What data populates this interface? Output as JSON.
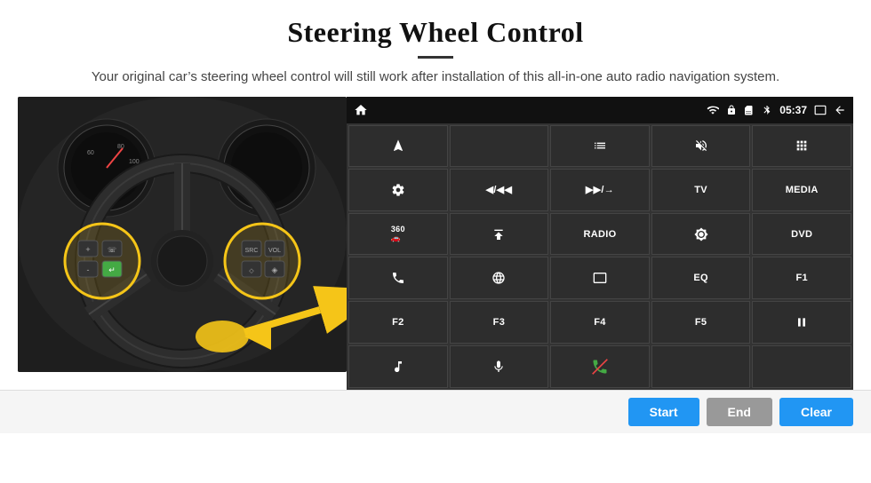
{
  "header": {
    "title": "Steering Wheel Control",
    "subtitle": "Your original car’s steering wheel control will still work after installation of this all-in-one auto radio navigation system."
  },
  "status_bar": {
    "time": "05:37",
    "icons": [
      "wifi",
      "lock",
      "sim",
      "bluetooth",
      "battery",
      "screen",
      "back"
    ]
  },
  "button_grid": [
    {
      "id": "r0c0",
      "type": "icon",
      "icon": "home",
      "label": ""
    },
    {
      "id": "r0c1",
      "type": "icon",
      "icon": "send",
      "label": ""
    },
    {
      "id": "r0c2",
      "type": "icon",
      "icon": "list",
      "label": ""
    },
    {
      "id": "r0c3",
      "type": "icon",
      "icon": "mute",
      "label": ""
    },
    {
      "id": "r0c4",
      "type": "icon",
      "icon": "dots",
      "label": ""
    },
    {
      "id": "r1c0",
      "type": "icon",
      "icon": "settings-circle",
      "label": ""
    },
    {
      "id": "r1c1",
      "type": "text",
      "label": "◀/◀◀"
    },
    {
      "id": "r1c2",
      "type": "text",
      "label": "▶▶/→"
    },
    {
      "id": "r1c3",
      "type": "text",
      "label": "TV"
    },
    {
      "id": "r1c4",
      "type": "text",
      "label": "MEDIA"
    },
    {
      "id": "r2c0",
      "type": "text",
      "label": "360"
    },
    {
      "id": "r2c1",
      "type": "icon",
      "icon": "eject",
      "label": ""
    },
    {
      "id": "r2c2",
      "type": "text",
      "label": "RADIO"
    },
    {
      "id": "r2c3",
      "type": "icon",
      "icon": "brightness",
      "label": ""
    },
    {
      "id": "r2c4",
      "type": "text",
      "label": "DVD"
    },
    {
      "id": "r3c0",
      "type": "icon",
      "icon": "phone",
      "label": ""
    },
    {
      "id": "r3c1",
      "type": "icon",
      "icon": "globe",
      "label": ""
    },
    {
      "id": "r3c2",
      "type": "icon",
      "icon": "screen-mirror",
      "label": ""
    },
    {
      "id": "r3c3",
      "type": "text",
      "label": "EQ"
    },
    {
      "id": "r3c4",
      "type": "text",
      "label": "F1"
    },
    {
      "id": "r4c0",
      "type": "text",
      "label": "F2"
    },
    {
      "id": "r4c1",
      "type": "text",
      "label": "F3"
    },
    {
      "id": "r4c2",
      "type": "text",
      "label": "F4"
    },
    {
      "id": "r4c3",
      "type": "text",
      "label": "F5"
    },
    {
      "id": "r4c4",
      "type": "icon",
      "icon": "play-pause",
      "label": ""
    },
    {
      "id": "r5c0",
      "type": "icon",
      "icon": "music",
      "label": ""
    },
    {
      "id": "r5c1",
      "type": "icon",
      "icon": "mic",
      "label": ""
    },
    {
      "id": "r5c2",
      "type": "icon",
      "icon": "call-end",
      "label": ""
    },
    {
      "id": "r5c3",
      "type": "text",
      "label": ""
    },
    {
      "id": "r5c4",
      "type": "text",
      "label": ""
    }
  ],
  "bottom_buttons": {
    "start_label": "Start",
    "end_label": "End",
    "clear_label": "Clear"
  }
}
